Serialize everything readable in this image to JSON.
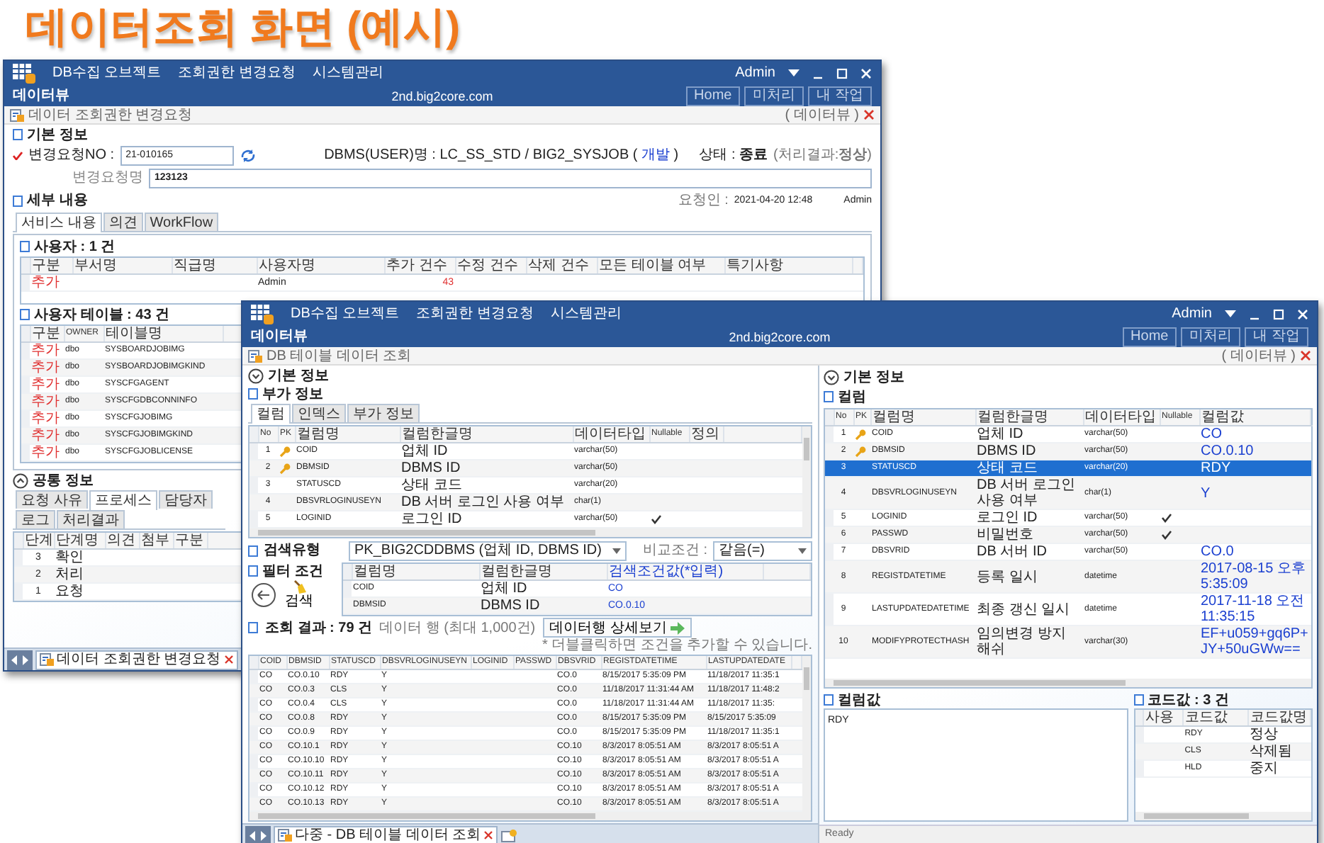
{
  "slide_title": "데이터조회 화면 (예시)",
  "back_window": {
    "kind": "request",
    "menu": [
      "DB수집 오브젝트",
      "조회권한 변경요청",
      "시스템관리"
    ],
    "app_name": "데이터뷰",
    "host": "2nd.big2core.com",
    "user": "Admin",
    "nav_buttons": [
      "Home",
      "미처리",
      "내 작업"
    ],
    "page_title": "데이터 조회권한 변경요청",
    "page_tag": "( 데이터뷰 )",
    "basic": {
      "heading": "기본 정보",
      "request_no_label": "변경요청NO :",
      "request_no": "21-010165",
      "dbms_info": "DBMS(USER)명 : LC_SS_STD / BIG2_SYSJOB (",
      "dbms_env": "개발",
      "dbms_info_end": ")",
      "status": "상태 : **종료**",
      "result": "(처리결과:**정상**)",
      "request_name_label": "변경요청명",
      "request_name": "123123"
    },
    "detail": {
      "heading": "세부 내용",
      "requester_label": "요청인 :",
      "requested_at": "2021-04-20 12:48",
      "requester": "Admin",
      "tabs": [
        {
          "label": "서비스 내용",
          "selected": true
        },
        {
          "label": "의견",
          "selected": false
        },
        {
          "label": "WorkFlow",
          "selected": false
        }
      ],
      "users_heading": "사용자 : 1 건",
      "users_columns": [
        "구분",
        "부서명",
        "직급명",
        "사용자명",
        "추가 건수",
        "수정 건수",
        "삭제 건수",
        "모든 테이블 여부",
        "특기사항"
      ],
      "users_rows": [
        {
          "category": "추가",
          "user_name": "Admin",
          "added_count": "43"
        }
      ],
      "tables_heading": "사용자 테이블 : 43 건",
      "tables_columns": [
        "구분",
        "OWNER",
        "테이블명"
      ],
      "tables_rows": [
        {
          "category": "추가",
          "owner": "dbo",
          "table_name": "SYSBOARDJOBIMG"
        },
        {
          "category": "추가",
          "owner": "dbo",
          "table_name": "SYSBOARDJOBIMGKIND"
        },
        {
          "category": "추가",
          "owner": "dbo",
          "table_name": "SYSCFGAGENT"
        },
        {
          "category": "추가",
          "owner": "dbo",
          "table_name": "SYSCFGDBCONNINFO"
        },
        {
          "category": "추가",
          "owner": "dbo",
          "table_name": "SYSCFGJOBIMG"
        },
        {
          "category": "추가",
          "owner": "dbo",
          "table_name": "SYSCFGJOBIMGKIND"
        },
        {
          "category": "추가",
          "owner": "dbo",
          "table_name": "SYSCFGJOBLICENSE"
        }
      ]
    },
    "common": {
      "heading": "공통 정보",
      "tabs": [
        {
          "label": "요청 사유",
          "selected": false
        },
        {
          "label": "프로세스",
          "selected": true
        },
        {
          "label": "담당자",
          "selected": false
        },
        {
          "label": "로그",
          "selected": false
        },
        {
          "label": "처리결과",
          "selected": false
        }
      ],
      "columns": [
        "단계",
        "단계명",
        "의견",
        "첨부",
        "구분"
      ],
      "rows": [
        {
          "step": "3",
          "step_name": "확인"
        },
        {
          "step": "2",
          "step_name": "처리"
        },
        {
          "step": "1",
          "step_name": "요청"
        }
      ]
    },
    "taskbar_tab": "데이터 조회권한 변경요청"
  },
  "front_window": {
    "kind": "query",
    "menu": [
      "DB수집 오브젝트",
      "조회권한 변경요청",
      "시스템관리"
    ],
    "app_name": "데이터뷰",
    "host": "2nd.big2core.com",
    "user": "Admin",
    "nav_buttons": [
      "Home",
      "미처리",
      "내 작업"
    ],
    "page_title": "DB 테이블 데이터 조회",
    "page_tag": "( 데이터뷰 )",
    "left": {
      "basic_heading": "기본 정보",
      "extra_heading": "부가 정보",
      "tabs": [
        {
          "label": "컬럼",
          "selected": true
        },
        {
          "label": "인덱스",
          "selected": false
        },
        {
          "label": "부가 정보",
          "selected": false
        }
      ],
      "columns": [
        "No",
        "PK",
        "컬럼명",
        "컬럼한글명",
        "데이터타입",
        "Nullable",
        "정의"
      ],
      "rows": [
        {
          "no": "1",
          "pk": true,
          "name": "COID",
          "korean_name": "업체 ID",
          "data_type": "varchar(50)",
          "nullable": false
        },
        {
          "no": "2",
          "pk": true,
          "name": "DBMSID",
          "korean_name": "DBMS ID",
          "data_type": "varchar(50)",
          "nullable": false
        },
        {
          "no": "3",
          "pk": false,
          "name": "STATUSCD",
          "korean_name": "상태 코드",
          "data_type": "varchar(20)",
          "nullable": false
        },
        {
          "no": "4",
          "pk": false,
          "name": "DBSVRLOGINUSEYN",
          "korean_name": "DB 서버 로그인 사용 여부",
          "data_type": "char(1)",
          "nullable": false
        },
        {
          "no": "5",
          "pk": false,
          "name": "LOGINID",
          "korean_name": "로그인 ID",
          "data_type": "varchar(50)",
          "nullable": true
        }
      ],
      "search_type_label": "검색유형",
      "search_type": "PK_BIG2CDDBMS (업체 ID, DBMS ID)",
      "compare_label": "비교조건 :",
      "compare": "같음(=)",
      "filter_label": "필터 조건",
      "search_button": "검색",
      "filter_columns": [
        "컬럼명",
        "컬럼한글명",
        "검색조건값(*입력)"
      ],
      "filter_rows": [
        {
          "name": "COID",
          "korean_name": "업체 ID",
          "value": "CO"
        },
        {
          "name": "DBMSID",
          "korean_name": "DBMS ID",
          "value": "CO.0.10"
        }
      ],
      "result_heading": "조회 결과 : 79 건",
      "result_note": "데이터 행 (최대 1,000건)",
      "detail_button": "데이터행 상세보기",
      "hint": "* 더블클릭하면 조건을 추가할 수 있습니다.",
      "result_columns": [
        "COID",
        "DBMSID",
        "STATUSCD",
        "DBSVRLOGINUSEYN",
        "LOGINID",
        "PASSWD",
        "DBSVRID",
        "REGISTDATETIME",
        "LASTUPDATEDATE"
      ],
      "result_rows": [
        {
          "coid": "CO",
          "dbmsid": "CO.0.10",
          "statuscd": "RDY",
          "dbsvrloginuseyn": "Y",
          "dbsvrid": "CO.0",
          "registdatetime": "8/15/2017 5:35:09 PM",
          "lastupdatedate": "11/18/2017 11:35:1"
        },
        {
          "coid": "CO",
          "dbmsid": "CO.0.3",
          "statuscd": "CLS",
          "dbsvrloginuseyn": "Y",
          "dbsvrid": "CO.0",
          "registdatetime": "11/18/2017 11:31:44 AM",
          "lastupdatedate": "11/18/2017 11:48:2"
        },
        {
          "coid": "CO",
          "dbmsid": "CO.0.4",
          "statuscd": "CLS",
          "dbsvrloginuseyn": "Y",
          "dbsvrid": "CO.0",
          "registdatetime": "11/18/2017 11:31:44 AM",
          "lastupdatedate": "11/18/2017 11:35:"
        },
        {
          "coid": "CO",
          "dbmsid": "CO.0.8",
          "statuscd": "RDY",
          "dbsvrloginuseyn": "Y",
          "dbsvrid": "CO.0",
          "registdatetime": "8/15/2017 5:35:09 PM",
          "lastupdatedate": "8/15/2017 5:35:09"
        },
        {
          "coid": "CO",
          "dbmsid": "CO.0.9",
          "statuscd": "RDY",
          "dbsvrloginuseyn": "Y",
          "dbsvrid": "CO.0",
          "registdatetime": "8/15/2017 5:35:09 PM",
          "lastupdatedate": "11/18/2017 11:35:1"
        },
        {
          "coid": "CO",
          "dbmsid": "CO.10.1",
          "statuscd": "RDY",
          "dbsvrloginuseyn": "Y",
          "dbsvrid": "CO.10",
          "registdatetime": "8/3/2017 8:05:51 AM",
          "lastupdatedate": "8/3/2017 8:05:51 A"
        },
        {
          "coid": "CO",
          "dbmsid": "CO.10.10",
          "statuscd": "RDY",
          "dbsvrloginuseyn": "Y",
          "dbsvrid": "CO.10",
          "registdatetime": "8/3/2017 8:05:51 AM",
          "lastupdatedate": "8/3/2017 8:05:51 A"
        },
        {
          "coid": "CO",
          "dbmsid": "CO.10.11",
          "statuscd": "RDY",
          "dbsvrloginuseyn": "Y",
          "dbsvrid": "CO.10",
          "registdatetime": "8/3/2017 8:05:51 AM",
          "lastupdatedate": "8/3/2017 8:05:51 A"
        },
        {
          "coid": "CO",
          "dbmsid": "CO.10.12",
          "statuscd": "RDY",
          "dbsvrloginuseyn": "Y",
          "dbsvrid": "CO.10",
          "registdatetime": "8/3/2017 8:05:51 AM",
          "lastupdatedate": "8/3/2017 8:05:51 A"
        },
        {
          "coid": "CO",
          "dbmsid": "CO.10.13",
          "statuscd": "RDY",
          "dbsvrloginuseyn": "Y",
          "dbsvrid": "CO.10",
          "registdatetime": "8/3/2017 8:05:51 AM",
          "lastupdatedate": "8/3/2017 8:05:51 A"
        }
      ],
      "taskbar_tab": "다중 - DB 테이블 데이터 조회"
    },
    "right": {
      "basic_heading": "기본 정보",
      "columns_heading": "컬럼",
      "columns": [
        "No",
        "PK",
        "컬럼명",
        "컬럼한글명",
        "데이터타입",
        "Nullable",
        "컬럼값"
      ],
      "rows": [
        {
          "no": "1",
          "pk": true,
          "name": "COID",
          "korean_name": "업체 ID",
          "data_type": "varchar(50)",
          "nullable": false,
          "value": "CO",
          "selected": false
        },
        {
          "no": "2",
          "pk": true,
          "name": "DBMSID",
          "korean_name": "DBMS ID",
          "data_type": "varchar(50)",
          "nullable": false,
          "value": "CO.0.10",
          "selected": false
        },
        {
          "no": "3",
          "pk": false,
          "name": "STATUSCD",
          "korean_name": "상태 코드",
          "data_type": "varchar(20)",
          "nullable": false,
          "value": "RDY",
          "selected": true
        },
        {
          "no": "4",
          "pk": false,
          "name": "DBSVRLOGINUSEYN",
          "korean_name": "DB 서버 로그인 사용 여부",
          "data_type": "char(1)",
          "nullable": false,
          "value": "Y",
          "selected": false
        },
        {
          "no": "5",
          "pk": false,
          "name": "LOGINID",
          "korean_name": "로그인 ID",
          "data_type": "varchar(50)",
          "nullable": true,
          "selected": false
        },
        {
          "no": "6",
          "pk": false,
          "name": "PASSWD",
          "korean_name": "비밀번호",
          "data_type": "varchar(50)",
          "nullable": true,
          "selected": false
        },
        {
          "no": "7",
          "pk": false,
          "name": "DBSVRID",
          "korean_name": "DB 서버 ID",
          "data_type": "varchar(50)",
          "nullable": false,
          "value": "CO.0",
          "selected": false
        },
        {
          "no": "8",
          "pk": false,
          "name": "REGISTDATETIME",
          "korean_name": "등록 일시",
          "data_type": "datetime",
          "nullable": false,
          "value": "2017-08-15 오후 5:35:09",
          "selected": false
        },
        {
          "no": "9",
          "pk": false,
          "name": "LASTUPDATEDATETIME",
          "korean_name": "최종 갱신 일시",
          "data_type": "datetime",
          "nullable": false,
          "value": "2017-11-18 오전 11:35:15",
          "selected": false
        },
        {
          "no": "10",
          "pk": false,
          "name": "MODIFYPROTECTHASH",
          "korean_name": "임의변경 방지 해쉬",
          "data_type": "varchar(30)",
          "nullable": false,
          "value": "EF+u059+gq6P+JY+50uGWw==",
          "selected": false
        }
      ],
      "value_heading": "컬럼값",
      "value_text": "RDY",
      "code_heading": "코드값 : 3 건",
      "code_columns": [
        "사용",
        "코드값",
        "코드값명"
      ],
      "code_rows": [
        {
          "code": "RDY",
          "code_name": "정상"
        },
        {
          "code": "CLS",
          "code_name": "삭제됨"
        },
        {
          "code": "HLD",
          "code_name": "중지"
        }
      ]
    },
    "status_bar": "Ready"
  }
}
